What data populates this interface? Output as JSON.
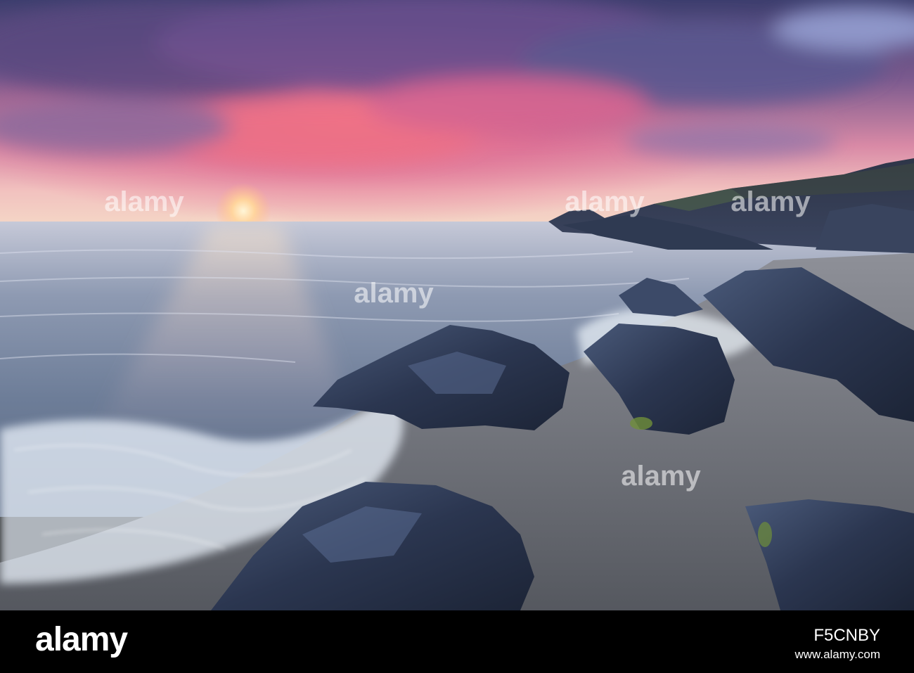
{
  "photo": {
    "subject": "sunset over rocky sea shore with crashing waves",
    "colors": {
      "sky_top": "#4a4a7a",
      "sky_glow": "#f06a7a",
      "sun": "#ffd9a0",
      "sea": "#8d9cb5",
      "rock": "#2e3a52",
      "sand": "#6b6f78"
    }
  },
  "watermark": {
    "text": "alamy",
    "marks": [
      "a",
      "l",
      "a",
      "m",
      "y"
    ]
  },
  "footer": {
    "logo": "alamy",
    "image_id": "F5CNBY",
    "url": "www.alamy.com"
  }
}
